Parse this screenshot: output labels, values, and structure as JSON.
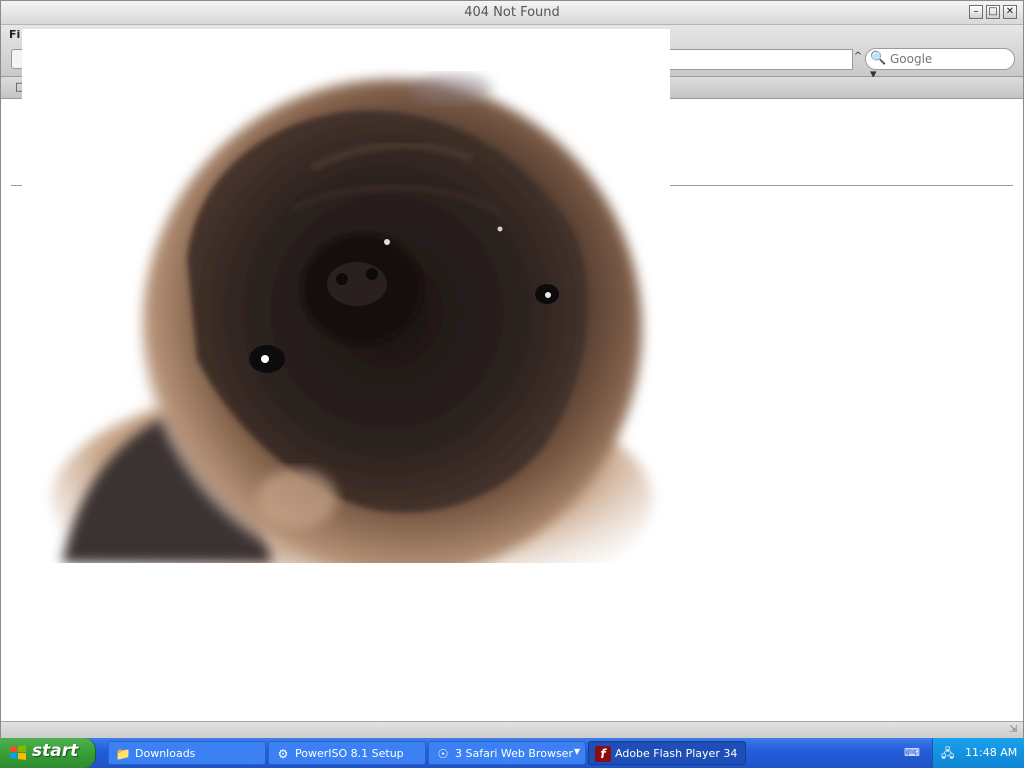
{
  "window": {
    "title": "404 Not Found",
    "menu_first": "Fi",
    "search_placeholder": "Google"
  },
  "taskbar": {
    "start_label": "start",
    "tasks": [
      {
        "label": "Downloads",
        "icon": "folder-icon"
      },
      {
        "label": "PowerISO 8.1 Setup",
        "icon": "setup-icon"
      },
      {
        "label": "3 Safari Web Browser",
        "icon": "safari-icon"
      },
      {
        "label": "Adobe Flash Player 34",
        "icon": "flash-icon"
      }
    ],
    "clock": "11:48 AM"
  },
  "colors": {
    "taskbar_blue": "#245edb",
    "start_green": "#379e37",
    "tray_blue": "#0f84d3",
    "flash_red": "#8b0d0d"
  }
}
